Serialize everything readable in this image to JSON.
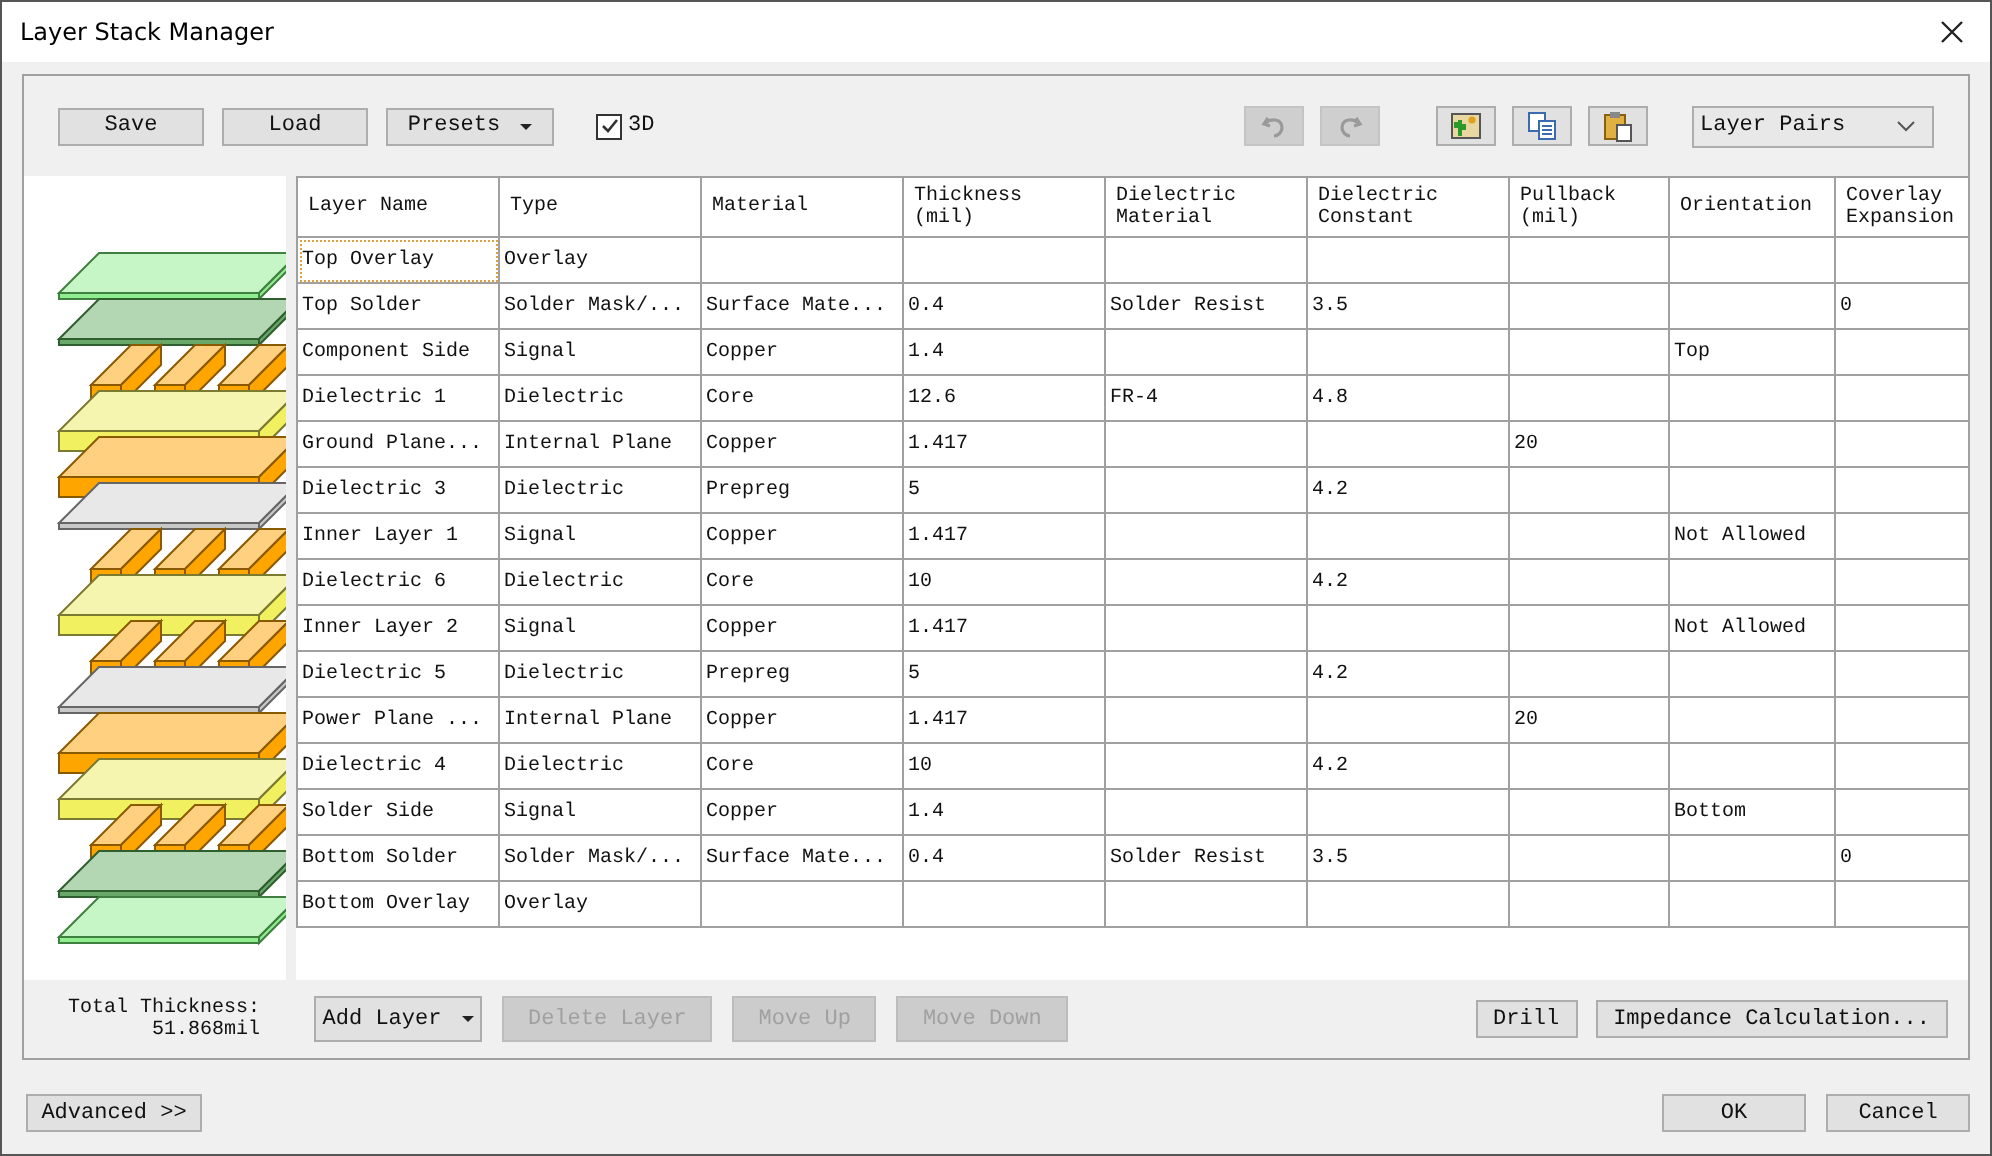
{
  "window": {
    "title": "Layer Stack Manager"
  },
  "toolbar": {
    "buttons": [
      {
        "label": "Save"
      },
      {
        "label": "Load"
      }
    ],
    "presets": {
      "label": "Presets"
    },
    "view_3d": {
      "label": "3D",
      "checked": true
    },
    "history": [
      {
        "kind": "undo",
        "disabled": true
      },
      {
        "kind": "redo",
        "disabled": true
      }
    ],
    "tools": [
      {
        "kind": "image"
      },
      {
        "kind": "copy"
      },
      {
        "kind": "paste"
      }
    ],
    "layer_pairs": {
      "value": "Layer Pairs"
    }
  },
  "table": {
    "columns": [
      "Layer Name",
      "Type",
      "Material",
      "Thickness\n(mil)",
      "Dielectric\nMaterial",
      "Dielectric\nConstant",
      "Pullback\n(mil)",
      "Orientation",
      "Coverlay\nExpansion"
    ],
    "rows": [
      {
        "kind": "overlay",
        "focused": true,
        "cells": [
          "Top Overlay",
          "Overlay",
          null,
          null,
          null,
          null,
          null,
          null,
          null
        ]
      },
      {
        "kind": "mask",
        "focused": false,
        "cells": [
          "Top Solder",
          "Solder Mask/...",
          "Surface Mate...",
          "0.4",
          "Solder Resist",
          "3.5",
          null,
          null,
          "0"
        ]
      },
      {
        "kind": "signal",
        "focused": false,
        "cells": [
          "Component Side",
          "Signal",
          "Copper",
          "1.4",
          null,
          null,
          null,
          "Top",
          null
        ]
      },
      {
        "kind": "core",
        "focused": false,
        "cells": [
          "Dielectric 1",
          "Dielectric",
          "Core",
          "12.6",
          "FR-4",
          "4.8",
          null,
          null,
          null
        ]
      },
      {
        "kind": "plane",
        "focused": false,
        "cells": [
          "Ground Plane...",
          "Internal Plane",
          "Copper",
          "1.417",
          null,
          null,
          "20",
          null,
          null
        ]
      },
      {
        "kind": "prepreg",
        "focused": false,
        "cells": [
          "Dielectric 3",
          "Dielectric",
          "Prepreg",
          "5",
          null,
          "4.2",
          null,
          null,
          null
        ]
      },
      {
        "kind": "signal",
        "focused": false,
        "cells": [
          "Inner Layer 1",
          "Signal",
          "Copper",
          "1.417",
          null,
          null,
          null,
          "Not Allowed",
          null
        ]
      },
      {
        "kind": "core",
        "focused": false,
        "cells": [
          "Dielectric 6",
          "Dielectric",
          "Core",
          "10",
          null,
          "4.2",
          null,
          null,
          null
        ]
      },
      {
        "kind": "signal",
        "focused": false,
        "cells": [
          "Inner Layer 2",
          "Signal",
          "Copper",
          "1.417",
          null,
          null,
          null,
          "Not Allowed",
          null
        ]
      },
      {
        "kind": "prepreg",
        "focused": false,
        "cells": [
          "Dielectric 5",
          "Dielectric",
          "Prepreg",
          "5",
          null,
          "4.2",
          null,
          null,
          null
        ]
      },
      {
        "kind": "plane",
        "focused": false,
        "cells": [
          "Power Plane ...",
          "Internal Plane",
          "Copper",
          "1.417",
          null,
          null,
          "20",
          null,
          null
        ]
      },
      {
        "kind": "core",
        "focused": false,
        "cells": [
          "Dielectric 4",
          "Dielectric",
          "Core",
          "10",
          null,
          "4.2",
          null,
          null,
          null
        ]
      },
      {
        "kind": "signal",
        "focused": false,
        "cells": [
          "Solder Side",
          "Signal",
          "Copper",
          "1.4",
          null,
          null,
          null,
          "Bottom",
          null
        ]
      },
      {
        "kind": "mask",
        "focused": false,
        "cells": [
          "Bottom Solder",
          "Solder Mask/...",
          "Surface Mate...",
          "0.4",
          "Solder Resist",
          "3.5",
          null,
          null,
          "0"
        ]
      },
      {
        "kind": "overlay",
        "focused": false,
        "cells": [
          "Bottom Overlay",
          "Overlay",
          null,
          null,
          null,
          null,
          null,
          null,
          null
        ]
      }
    ]
  },
  "total_thickness": {
    "label": "Total Thickness:",
    "value": "51.868mil"
  },
  "layer_buttons": [
    {
      "label": "Add Layer",
      "kind": "dropdown",
      "disabled": false
    },
    {
      "label": "Delete Layer",
      "kind": "plain",
      "disabled": true
    },
    {
      "label": "Move Up",
      "kind": "plain",
      "disabled": true
    },
    {
      "label": "Move Down",
      "kind": "plain",
      "disabled": true
    }
  ],
  "tool_buttons": [
    {
      "label": "Drill"
    },
    {
      "label": "Impedance Calculation..."
    }
  ],
  "footer": {
    "advanced": "Advanced >>",
    "buttons": [
      {
        "label": "OK"
      },
      {
        "label": "Cancel"
      }
    ]
  }
}
